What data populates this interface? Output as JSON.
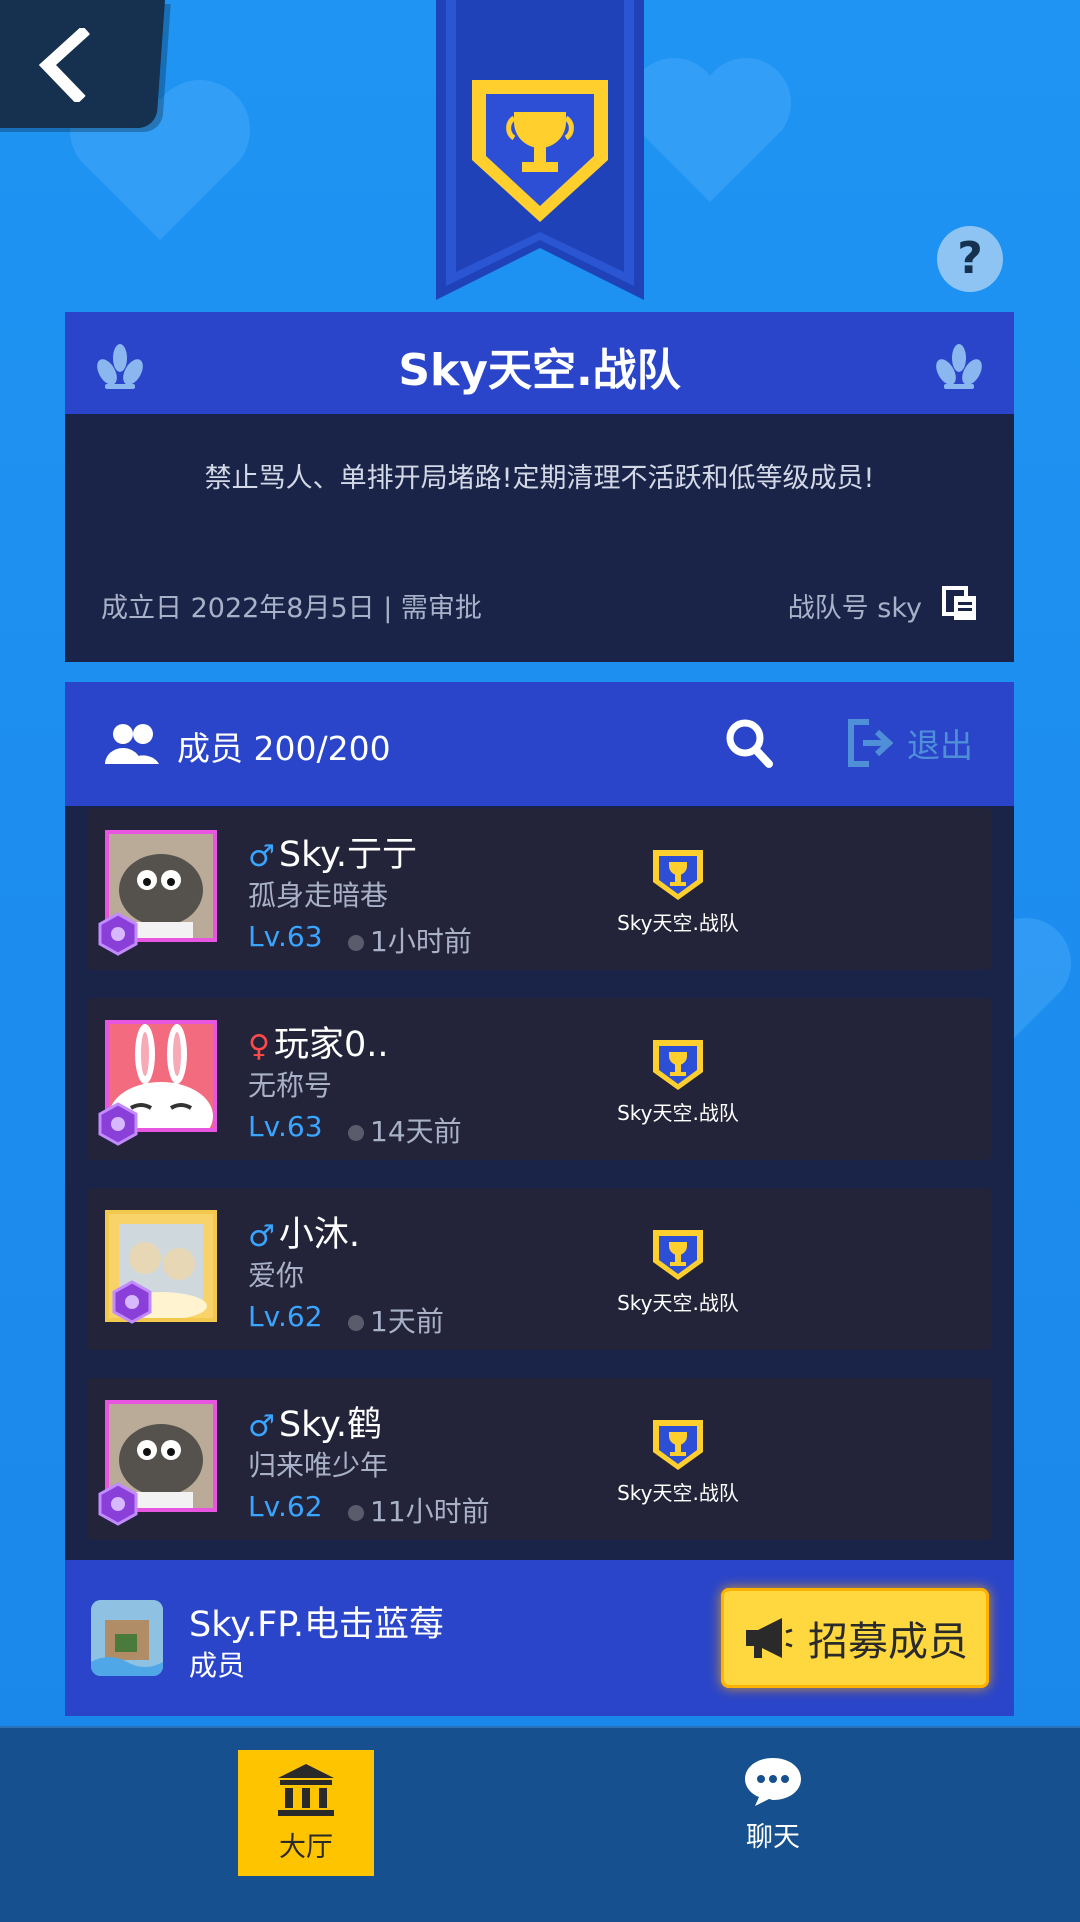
{
  "team": {
    "name": "Sky天空.战队",
    "slogan": "禁止骂人、单排开局堵路!定期清理不活跃和低等级成员!",
    "founded": "成立日 2022年8月5日 | 需审批",
    "team_no": "战队号 sky"
  },
  "members_section": {
    "count_label": "成员 200/200",
    "quit_label": "退出"
  },
  "members": [
    {
      "gender": "♂",
      "gender_color": "#3aa5ff",
      "name": "Sky.亍亍",
      "title": "孤身走暗巷",
      "level": "Lv.63",
      "last_seen": "1小时前",
      "team": "Sky天空.战队",
      "avatar": "sheep"
    },
    {
      "gender": "♀",
      "gender_color": "#ff4a4a",
      "name": "玩家0..",
      "title": "无称号",
      "level": "Lv.63",
      "last_seen": "14天前",
      "team": "Sky天空.战队",
      "avatar": "bunny"
    },
    {
      "gender": "♂",
      "gender_color": "#3aa5ff",
      "name": "小沐.",
      "title": "爱你",
      "level": "Lv.62",
      "last_seen": "1天前",
      "team": "Sky天空.战队",
      "avatar": "cartoon"
    },
    {
      "gender": "♂",
      "gender_color": "#3aa5ff",
      "name": "Sky.鹤",
      "title": "归来唯少年",
      "level": "Lv.62",
      "last_seen": "11小时前",
      "team": "Sky天空.战队",
      "avatar": "sheep"
    }
  ],
  "self": {
    "name": "Sky.FP.电击蓝莓",
    "role": "成员",
    "recruit_label": "招募成员"
  },
  "tabs": {
    "hall": "大厅",
    "chat": "聊天"
  },
  "help_label": "?",
  "colors": {
    "accent_yellow": "#ffd83f",
    "panel_blue": "#2a45c9",
    "panel_dark": "#1a2448",
    "level_blue": "#3aa5ff"
  }
}
